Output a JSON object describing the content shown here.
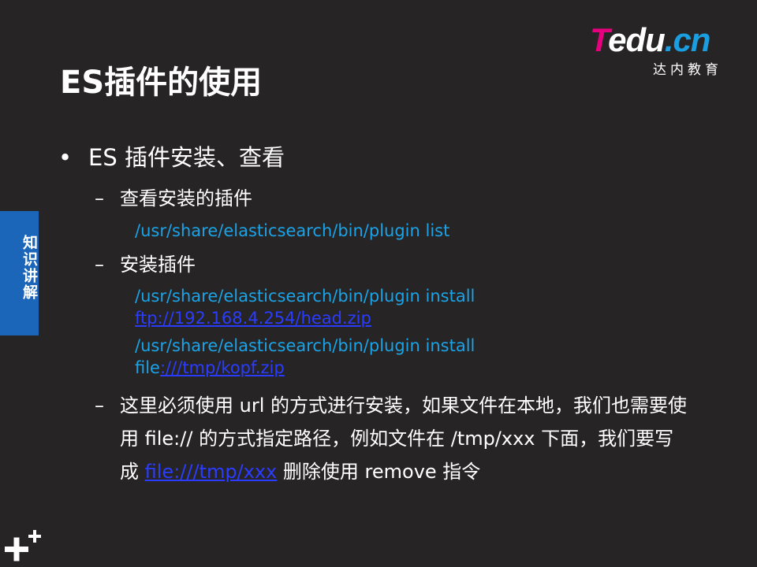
{
  "title": "ES插件的使用",
  "logo": {
    "t": "T",
    "rest": "edu",
    "dotcn": ".cn",
    "subtitle": "达内教育"
  },
  "side_tab": {
    "label": "知识讲解",
    "color": "#1b66b9"
  },
  "bullet": {
    "symbol": "•",
    "text": "ES  插件安装、查看"
  },
  "sub_items": [
    {
      "dash": "–",
      "label": "查看安装的插件"
    },
    {
      "dash": "–",
      "label": "安装插件"
    },
    {
      "dash": "–"
    }
  ],
  "commands": {
    "list": "/usr/share/elasticsearch/bin/plugin  list",
    "install1_line1": "/usr/share/elasticsearch/bin/plugin  install",
    "install1_link": "ftp://192.168.4.254/head.zip",
    "install2_line1": "/usr/share/elasticsearch/bin/plugin  install",
    "install2_prefix": "file",
    "install2_link": ":///tmp/kopf.zip"
  },
  "note": {
    "part1": "这里必须使用 url 的方式进行安装，如果文件在本地，我们也需要使用 file:// 的方式指定路径，例如文件在 /tmp/xxx 下面，我们要写成 ",
    "link": "file:///tmp/xxx",
    "part2": " 删除使用 remove 指令"
  },
  "colors": {
    "background": "#272425",
    "command_text": "#1aa3e6",
    "link": "#2a3cff",
    "logo_magenta": "#e6007e",
    "logo_blue": "#1a9ee0"
  },
  "icons": {
    "corner": "plus-plus-icon"
  }
}
